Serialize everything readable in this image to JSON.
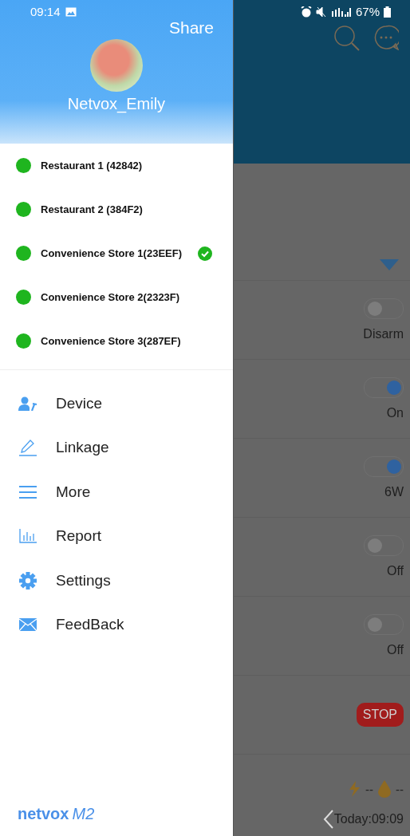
{
  "status_bar": {
    "time": "09:14",
    "battery": "67%"
  },
  "drawer": {
    "share": "Share",
    "user_name": "Netvox_Emily",
    "sites": [
      {
        "name": "Restaurant 1 (42842)",
        "selected": false
      },
      {
        "name": "Restaurant 2 (384F2)",
        "selected": false
      },
      {
        "name": "Convenience Store 1(23EEF)",
        "selected": true
      },
      {
        "name": "Convenience Store 2(2323F)",
        "selected": false
      },
      {
        "name": "Convenience Store 3(287EF)",
        "selected": false
      }
    ],
    "menu": [
      "Device",
      "Linkage",
      "More",
      "Report",
      "Settings",
      "FeedBack"
    ],
    "logo": {
      "brand": "netvox",
      "model": "M2"
    }
  },
  "background": {
    "rows": [
      {
        "kind": "toggle",
        "on": false,
        "value": "Disarm"
      },
      {
        "kind": "toggle",
        "on": true,
        "value": "On"
      },
      {
        "kind": "toggle",
        "on": true,
        "value": "6W"
      },
      {
        "kind": "toggle",
        "on": false,
        "value": "Off"
      },
      {
        "kind": "toggle",
        "on": false,
        "value": "Off"
      },
      {
        "kind": "button",
        "label": "STOP"
      }
    ],
    "power": "--",
    "water": "--",
    "updated": "Today:09:09"
  }
}
